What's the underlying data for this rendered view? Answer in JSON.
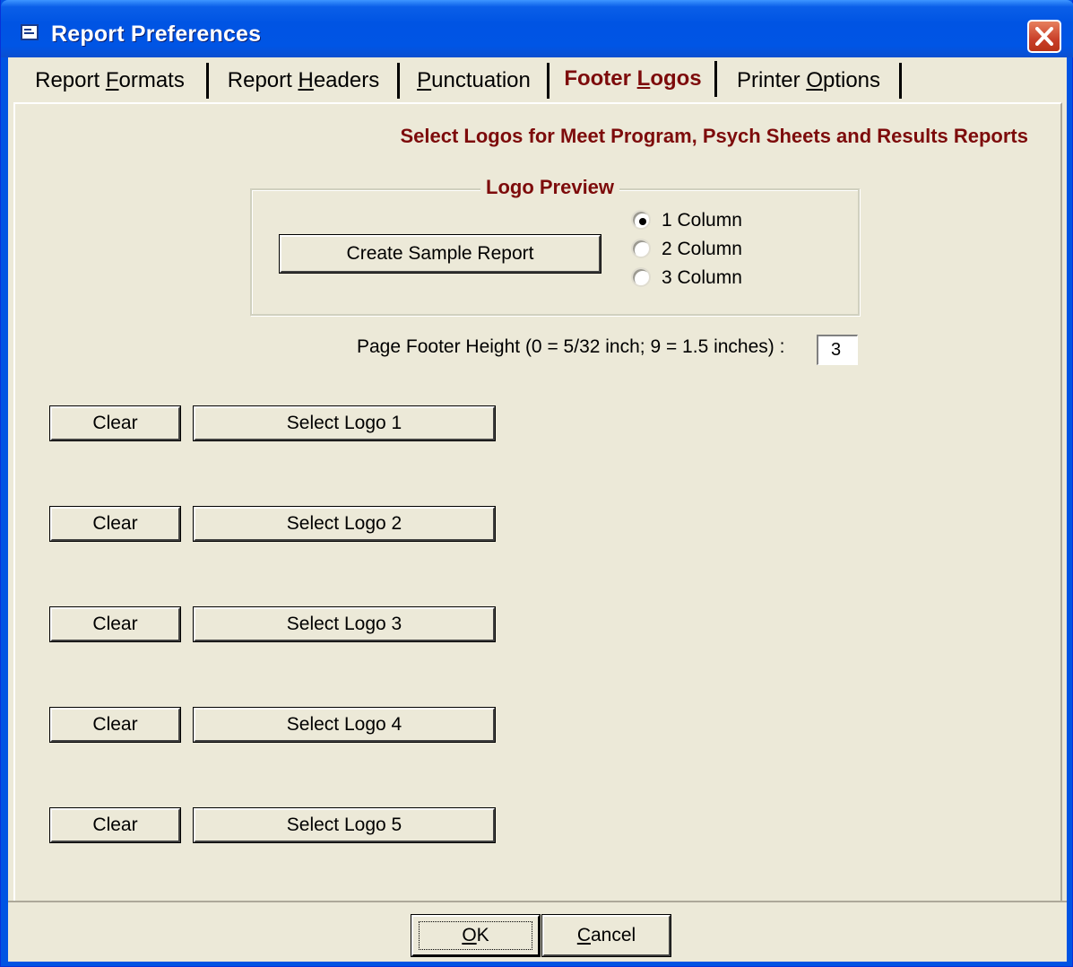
{
  "window": {
    "title": "Report Preferences",
    "title_icon": "report-window-icon",
    "close_icon": "close-icon"
  },
  "tabs": [
    {
      "label_pre": "Report ",
      "label_u": "F",
      "label_post": "ormats",
      "active": false
    },
    {
      "label_pre": "Report ",
      "label_u": "H",
      "label_post": "eaders",
      "active": false
    },
    {
      "label_pre": "",
      "label_u": "P",
      "label_post": "unctuation",
      "active": false
    },
    {
      "label_pre": "Footer ",
      "label_u": "L",
      "label_post": "ogos",
      "active": true
    },
    {
      "label_pre": "Printer ",
      "label_u": "O",
      "label_post": "ptions",
      "active": false
    }
  ],
  "panel": {
    "heading": "Select Logos for Meet Program, Psych Sheets and Results Reports",
    "preview_group": {
      "legend": "Logo Preview",
      "create_button": "Create Sample Report",
      "columns": [
        {
          "label": "1 Column",
          "selected": true
        },
        {
          "label": "2 Column",
          "selected": false
        },
        {
          "label": "3 Column",
          "selected": false
        }
      ]
    },
    "footer_height": {
      "label": "Page Footer Height (0 = 5/32 inch; 9 = 1.5 inches) :",
      "value": "3"
    },
    "logos": [
      {
        "clear": "Clear",
        "select": "Select Logo 1"
      },
      {
        "clear": "Clear",
        "select": "Select Logo 2"
      },
      {
        "clear": "Clear",
        "select": "Select Logo 3"
      },
      {
        "clear": "Clear",
        "select": "Select Logo 4"
      },
      {
        "clear": "Clear",
        "select": "Select Logo 5"
      }
    ]
  },
  "buttons": {
    "ok_u": "O",
    "ok_post": "K",
    "cancel_u": "C",
    "cancel_post": "ancel"
  },
  "colors": {
    "accent_text": "#7d0b0b",
    "face": "#ece9d8",
    "titlebar": "#0054e3"
  }
}
